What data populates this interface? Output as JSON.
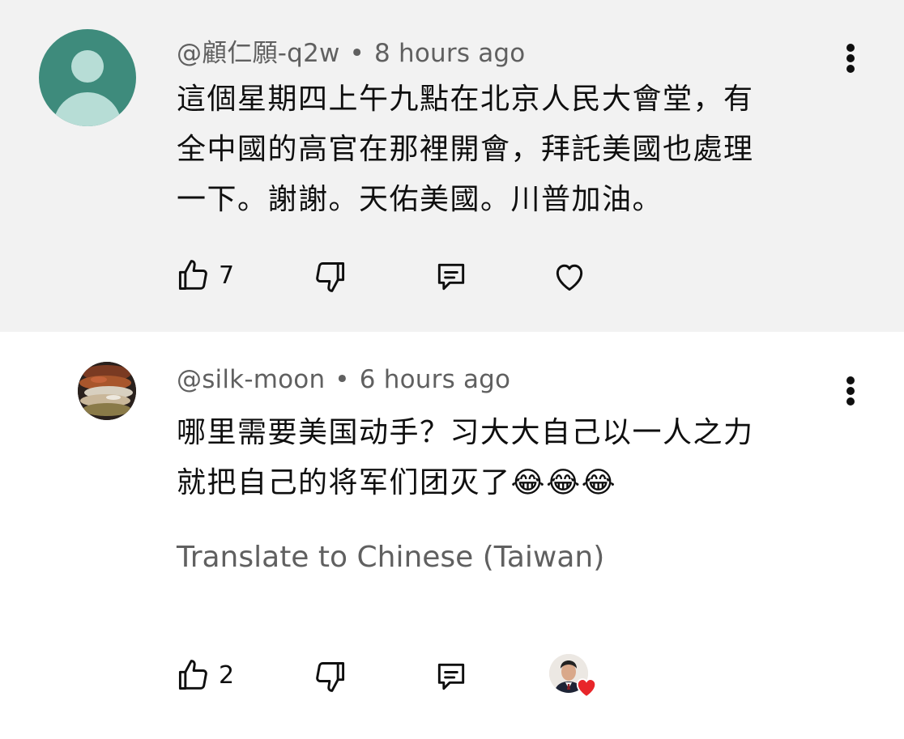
{
  "comments": [
    {
      "handle": "@顧仁願-q2w",
      "time": "8 hours ago",
      "lines": [
        "這個星期四上午九點在北京人民大會堂，有",
        "全中國的高官在那裡開會，拜託美國也處理",
        "一下。謝謝。天佑美國。川普加油。"
      ],
      "likes": "7",
      "avatar_icon": "default-user-avatar",
      "bg_color": "#f2f2f2"
    },
    {
      "handle": "@silk-moon",
      "time": "6 hours ago",
      "lines": [
        "哪里需要美国动手？习大大自己以一人之力",
        "就把自己的将军们团灭了😂😂😂"
      ],
      "likes": "2",
      "translate_label": "Translate to Chinese (Taiwan)",
      "creator_hearted": true,
      "bg_color": "#ffffff"
    }
  ],
  "icons": {
    "like": "thumbs-up-icon",
    "dislike": "thumbs-down-icon",
    "reply": "reply-comment-icon",
    "heart": "heart-outline-icon",
    "more": "more-vertical-icon",
    "heart_badge_color": "#e8262a"
  },
  "separator": "•"
}
